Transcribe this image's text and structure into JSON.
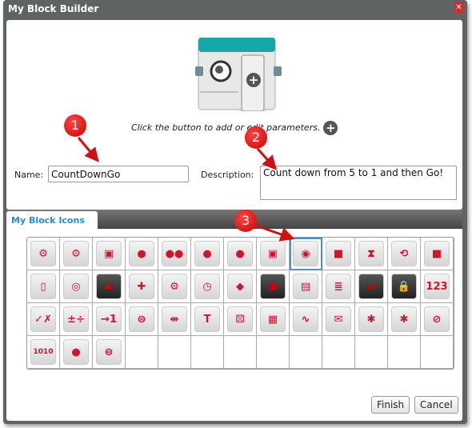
{
  "window": {
    "title": "My Block Builder",
    "close": "✕"
  },
  "header": {
    "hint": "Click the button to add or edit parameters.",
    "add_param": "+"
  },
  "form": {
    "name_label": "Name:",
    "name_value": "CountDownGo",
    "description_label": "Description:",
    "description_value": "Count down from 5 to 1 and then Go!"
  },
  "tabs": [
    {
      "label": "My Block Icons"
    }
  ],
  "icons": [
    {
      "name": "brain-gear-red",
      "glyph": "⚙"
    },
    {
      "name": "brain-gear-gray",
      "glyph": "⚙"
    },
    {
      "name": "medium-motor",
      "glyph": "▣"
    },
    {
      "name": "large-motor",
      "glyph": "●"
    },
    {
      "name": "move-tank",
      "glyph": "●●"
    },
    {
      "name": "move-steering",
      "glyph": "●"
    },
    {
      "name": "move-tank-adjust",
      "glyph": "●"
    },
    {
      "name": "display",
      "glyph": "▣"
    },
    {
      "name": "sound",
      "glyph": "◉"
    },
    {
      "name": "brick-buttons",
      "glyph": "■"
    },
    {
      "name": "hourglass-wait",
      "glyph": "⧗"
    },
    {
      "name": "loop-interrupt",
      "glyph": "⟲"
    },
    {
      "name": "brick-status-light",
      "glyph": "■"
    },
    {
      "name": "touch-sensor",
      "glyph": "▯"
    },
    {
      "name": "gyro-sensor",
      "glyph": "◎"
    },
    {
      "name": "color-sensor",
      "glyph": "▬"
    },
    {
      "name": "ir-beacon",
      "glyph": "✚"
    },
    {
      "name": "motor-rotation",
      "glyph": "⚙"
    },
    {
      "name": "timer",
      "glyph": "◷"
    },
    {
      "name": "ultrasonic-sensor",
      "glyph": "◆"
    },
    {
      "name": "ir-sensor",
      "glyph": "●"
    },
    {
      "name": "energy-meter",
      "glyph": "▤"
    },
    {
      "name": "data-logging",
      "glyph": "≣"
    },
    {
      "name": "case",
      "glyph": "▰"
    },
    {
      "name": "case-locked",
      "glyph": "🔒"
    },
    {
      "name": "array",
      "glyph": "123"
    },
    {
      "name": "logic",
      "glyph": "✓✗"
    },
    {
      "name": "math",
      "glyph": "±÷"
    },
    {
      "name": "round",
      "glyph": "→1"
    },
    {
      "name": "compare",
      "glyph": "⊜"
    },
    {
      "name": "range",
      "glyph": "⇹"
    },
    {
      "name": "text",
      "glyph": "T"
    },
    {
      "name": "random",
      "glyph": "⚄"
    },
    {
      "name": "file-access",
      "glyph": "▦"
    },
    {
      "name": "raw-sensor",
      "glyph": "∿"
    },
    {
      "name": "messaging",
      "glyph": "✉"
    },
    {
      "name": "bluetooth",
      "glyph": "✱"
    },
    {
      "name": "bluetooth-connect",
      "glyph": "✱"
    },
    {
      "name": "stop-sleep",
      "glyph": "⊘"
    },
    {
      "name": "binary",
      "glyph": "1010"
    },
    {
      "name": "unregulated-motor",
      "glyph": "●"
    },
    {
      "name": "compare-2",
      "glyph": "⊜"
    }
  ],
  "selected_icon": 8,
  "grid_cells": 52,
  "annotations": [
    "1",
    "2",
    "3"
  ],
  "buttons": {
    "finish": "Finish",
    "cancel": "Cancel"
  },
  "colors": {
    "accent": "#2a8ad6",
    "marker": "#d01010",
    "titlebar": "#5f6363"
  }
}
